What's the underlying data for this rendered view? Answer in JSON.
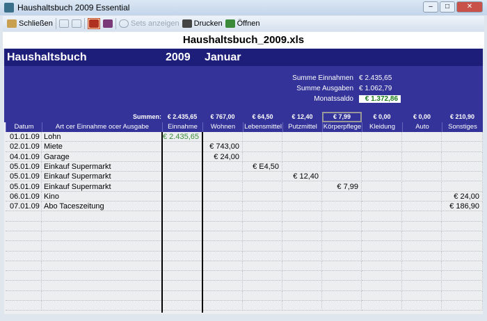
{
  "window": {
    "title": "Haushaltsbuch 2009 Essential"
  },
  "toolbar": {
    "close": "Schließen",
    "sets": "Sets anzeigen",
    "print": "Drucken",
    "open": "Öffnen"
  },
  "file_title": "Haushaltsbuch_2009.xls",
  "header": {
    "title": "Haushaltsbuch",
    "year": "2009",
    "month": "Januar"
  },
  "summary": {
    "income_label": "Summe Einnahmen",
    "income": "€ 2.435,65",
    "expense_label": "Summe Ausgaben",
    "expense": "€ 1.062,79",
    "balance_label": "Monatssaldo",
    "balance": "€ 1.372,86"
  },
  "sums": {
    "label": "Summen:",
    "values": [
      "€ 2.435,65",
      "€ 767,00",
      "€ 64,50",
      "€ 12,40",
      "€ 7,99",
      "€ 0,00",
      "€ 0,00",
      "€ 210,90"
    ]
  },
  "columns": [
    "Datum",
    "Art cer Einnahme ocer Ausgabe",
    "Einnahme",
    "Wohnen",
    "Lebensmittel",
    "Putzmittel",
    "Körperpflege",
    "Kleidung",
    "Auto",
    "Sonstiges"
  ],
  "rows": [
    [
      "01.01.09",
      "Lohn",
      "€ 2.435,65",
      "",
      "",
      "",
      "",
      "",
      "",
      ""
    ],
    [
      "02.01.09",
      "Miete",
      "",
      "€ 743,00",
      "",
      "",
      "",
      "",
      "",
      ""
    ],
    [
      "04.01.09",
      "Garage",
      "",
      "€ 24,00",
      "",
      "",
      "",
      "",
      "",
      ""
    ],
    [
      "05.01.09",
      "Einkauf Supermarkt",
      "",
      "",
      "€ E4,50",
      "",
      "",
      "",
      "",
      ""
    ],
    [
      "05.01.09",
      "Einkauf Supermarkt",
      "",
      "",
      "",
      "€ 12,40",
      "",
      "",
      "",
      ""
    ],
    [
      "05.01.09",
      "Einkauf Supermarkt",
      "",
      "",
      "",
      "",
      "€ 7,99",
      "",
      "",
      ""
    ],
    [
      "06.01.09",
      "Kino",
      "",
      "",
      "",
      "",
      "",
      "",
      "",
      "€ 24,00"
    ],
    [
      "07.01.09",
      "Abo Taceszeitung",
      "",
      "",
      "",
      "",
      "",
      "",
      "",
      "€ 186,90"
    ]
  ]
}
